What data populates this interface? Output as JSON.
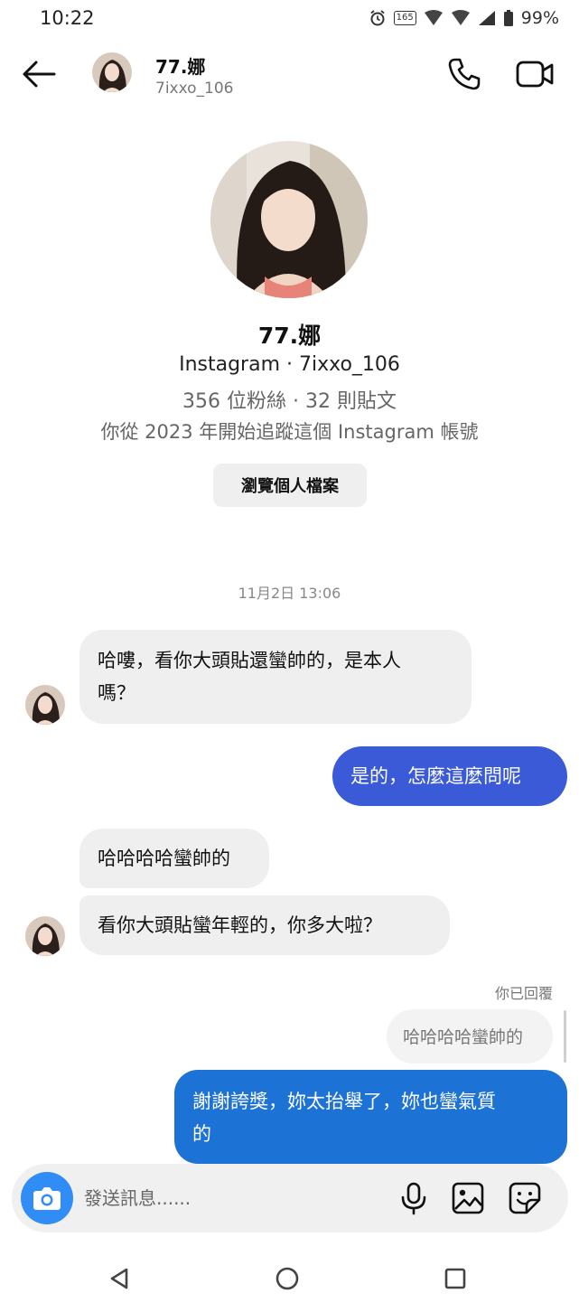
{
  "status_bar": {
    "time": "10:22",
    "chip_text": "165",
    "battery": "99%"
  },
  "header": {
    "name": "77.娜",
    "username": "7ixxo_106"
  },
  "profile": {
    "name": "77.娜",
    "line1": "Instagram · 7ixxo_106",
    "line2": "356 位粉絲 · 32 則貼文",
    "line3": "你從 2023 年開始追蹤這個 Instagram 帳號",
    "view_button": "瀏覽個人檔案"
  },
  "conversation": {
    "timestamp": "11月2日 13:06",
    "messages": [
      {
        "from": "them",
        "text_line1": "哈嘍，看你大頭貼還蠻帥的，是本人",
        "text_line2": "嗎？"
      },
      {
        "from": "me",
        "text": "是的，怎麼這麼問呢"
      },
      {
        "from": "them",
        "text": "哈哈哈哈蠻帥的"
      },
      {
        "from": "them",
        "text": "看你大頭貼蠻年輕的，你多大啦？"
      },
      {
        "from": "me",
        "replied_label": "你已回覆",
        "quoted": "哈哈哈哈蠻帥的",
        "text_line1": "謝謝誇獎，妳太抬舉了，妳也蠻氣質",
        "text_line2": "的"
      }
    ]
  },
  "composer": {
    "placeholder": "發送訊息......"
  },
  "icons": {
    "back": "arrow-left-icon",
    "call": "phone-icon",
    "video": "video-camera-icon",
    "camera": "camera-icon",
    "mic": "microphone-icon",
    "gallery": "image-icon",
    "sticker": "sticker-icon"
  },
  "colors": {
    "outgoing_bubble_1": "#3b5ad8",
    "outgoing_bubble_2": "#1d72d6",
    "incoming_bubble": "#efefef",
    "camera_button": "#2f8df5"
  }
}
